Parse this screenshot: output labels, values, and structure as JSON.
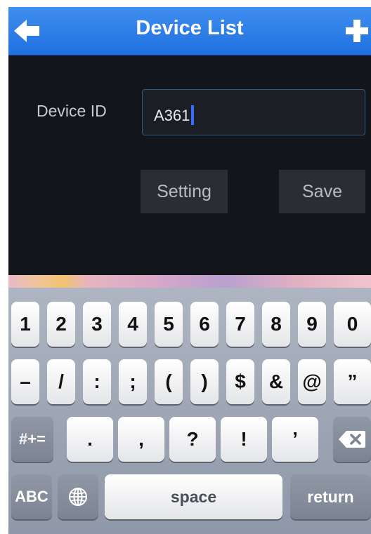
{
  "navbar": {
    "title": "Device List"
  },
  "form": {
    "device_id_label": "Device ID",
    "device_id_value": "A361",
    "setting_label": "Setting",
    "save_label": "Save"
  },
  "keyboard": {
    "row1": [
      "1",
      "2",
      "3",
      "4",
      "5",
      "6",
      "7",
      "8",
      "9",
      "0"
    ],
    "row2": [
      "–",
      "/",
      ":",
      ";",
      "(",
      ")",
      "$",
      "&",
      "@",
      "”"
    ],
    "row3": [
      ".",
      ",",
      "?",
      "!",
      "’"
    ],
    "symbols_label": "#+=",
    "abc_label": "ABC",
    "space_label": "space",
    "return_label": "return"
  },
  "icons": [
    "back-arrow-icon",
    "plus-icon",
    "globe-icon",
    "backspace-icon"
  ],
  "colors": {
    "navbar": "#2a7de8",
    "background": "#12161b",
    "caret": "#3b6bff"
  }
}
